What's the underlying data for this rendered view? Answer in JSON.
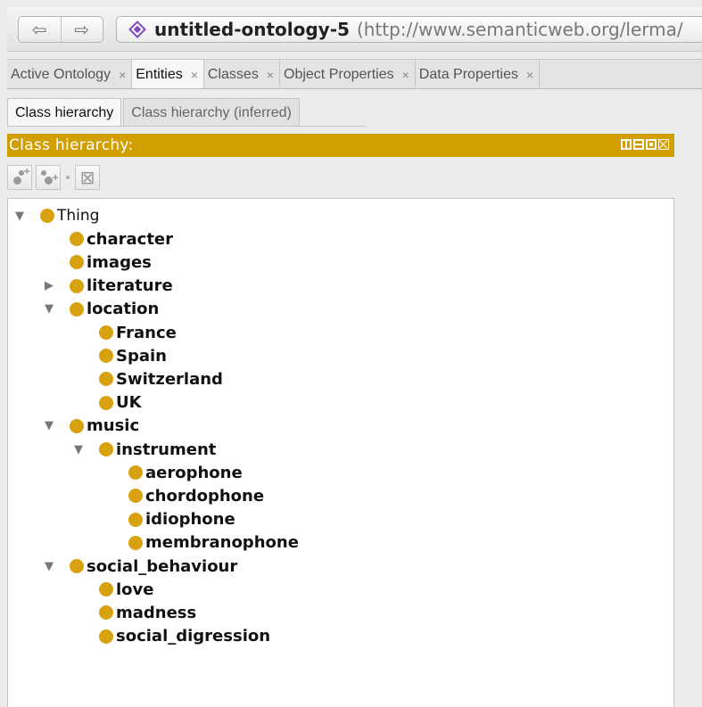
{
  "nav": {
    "back_glyph": "⇦",
    "forward_glyph": "⇨"
  },
  "address": {
    "ontology_name": "untitled-ontology-5",
    "ontology_iri": "(http://www.semanticweb.org/lerma/",
    "icon": "ontology-diamond-icon"
  },
  "tabs": [
    {
      "label": "Active Ontology",
      "close": "×"
    },
    {
      "label": "Entities",
      "close": "×"
    },
    {
      "label": "Classes",
      "close": "×"
    },
    {
      "label": "Object Properties",
      "close": "×"
    },
    {
      "label": "Data Properties",
      "close": "×"
    }
  ],
  "subtabs": [
    {
      "label": "Class hierarchy"
    },
    {
      "label": "Class hierarchy (inferred)"
    }
  ],
  "view": {
    "title": "Class hierarchy:",
    "toolbar_icons": [
      "add-subclass-icon",
      "add-sibling-icon",
      "delete-class-icon"
    ]
  },
  "colors": {
    "view_header": "#d19f00",
    "class_bullet": "#d8a10f",
    "ontology_accent": "#7b49b8"
  },
  "tree": [
    {
      "label": "Thing",
      "level": 0,
      "toggle": "▼"
    },
    {
      "label": "character",
      "level": 1,
      "toggle": ""
    },
    {
      "label": "images",
      "level": 1,
      "toggle": ""
    },
    {
      "label": "literature",
      "level": 1,
      "toggle": "▶"
    },
    {
      "label": "location",
      "level": 1,
      "toggle": "▼"
    },
    {
      "label": "France",
      "level": 2,
      "toggle": ""
    },
    {
      "label": "Spain",
      "level": 2,
      "toggle": ""
    },
    {
      "label": "Switzerland",
      "level": 2,
      "toggle": ""
    },
    {
      "label": "UK",
      "level": 2,
      "toggle": ""
    },
    {
      "label": "music",
      "level": 1,
      "toggle": "▼"
    },
    {
      "label": "instrument",
      "level": 2,
      "toggle": "▼"
    },
    {
      "label": "aerophone",
      "level": 3,
      "toggle": ""
    },
    {
      "label": "chordophone",
      "level": 3,
      "toggle": ""
    },
    {
      "label": "idiophone",
      "level": 3,
      "toggle": ""
    },
    {
      "label": "membranophone",
      "level": 3,
      "toggle": ""
    },
    {
      "label": "social_behaviour",
      "level": 1,
      "toggle": "▼"
    },
    {
      "label": "love",
      "level": 2,
      "toggle": ""
    },
    {
      "label": "madness",
      "level": 2,
      "toggle": ""
    },
    {
      "label": "social_digression",
      "level": 2,
      "toggle": ""
    }
  ]
}
